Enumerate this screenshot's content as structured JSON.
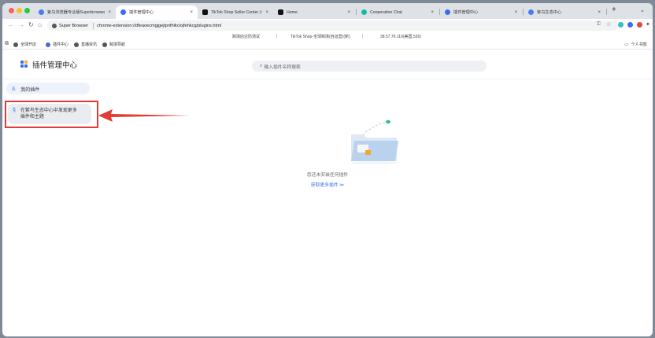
{
  "tabs": [
    {
      "title": "紫鸟浏览器专业版Superbrowser",
      "active": false
    },
    {
      "title": "插件管理中心",
      "active": true
    },
    {
      "title": "TikTok Shop Seller Center | Glo",
      "active": false
    },
    {
      "title": "Home",
      "active": false
    },
    {
      "title": "Cooperation Chat",
      "active": false
    },
    {
      "title": "插件管理中心",
      "active": false
    },
    {
      "title": "紫鸟生态中心",
      "active": false
    }
  ],
  "new_tab_label": "+",
  "tab_close": "×",
  "address_bar": {
    "browser_name": "Super Browser",
    "url": "chrome-extension://dfeaoecmgjgejlpnfhlkclojfehkcg/plugins.html"
  },
  "info_strip": {
    "env_label": "跨境店达防测试",
    "shop_label": "TikTok Shop-全球跨境(自运营)(新)",
    "ip_label": "38.57.79.119(美国,536)"
  },
  "bookmarks": [
    "全球开店",
    "插件中心",
    "直播资讯",
    "跨境导航"
  ],
  "bookmarks_right": "个人书签",
  "app": {
    "title": "插件管理中心",
    "search_placeholder": "输入插件名称搜索",
    "sidebar": [
      {
        "label": "我的插件"
      },
      {
        "label": "在紫鸟生态中心中发现更多插件和主题"
      }
    ],
    "empty_message": "您还未安装任何插件",
    "more_link": "获取更多插件 ≫"
  },
  "colors": {
    "accent": "#3b6cf0",
    "highlight": "#e53935"
  }
}
